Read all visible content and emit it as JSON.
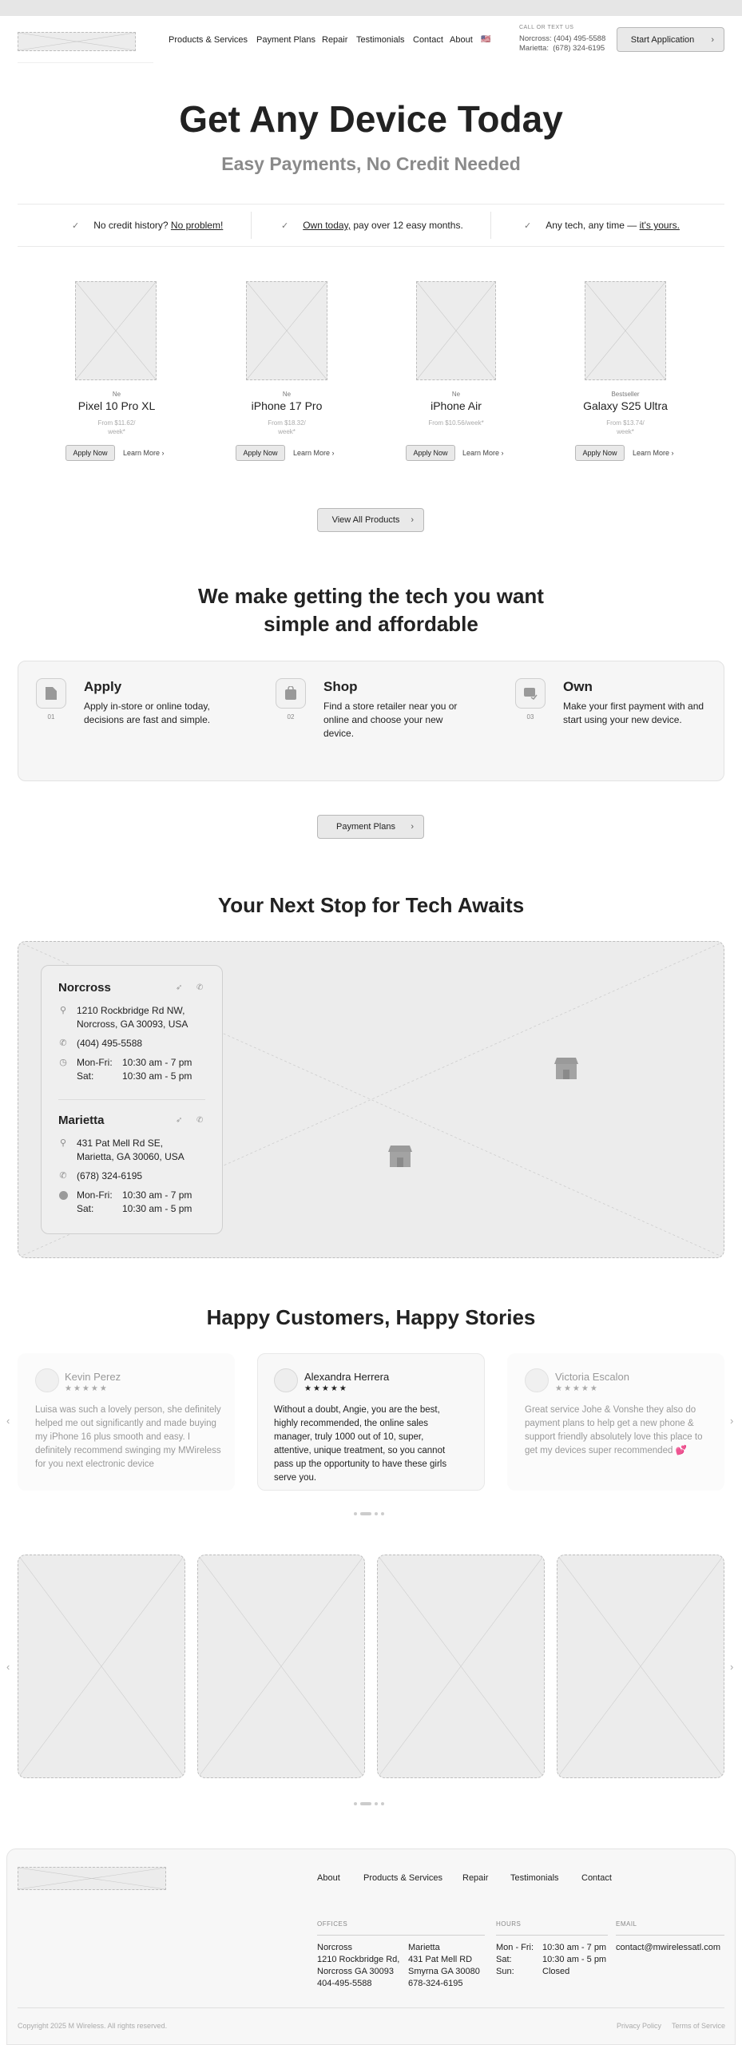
{
  "header": {
    "nav": [
      "Products & Services",
      "Payment Plans",
      "Repair",
      "Testimonials",
      "Contact",
      "About"
    ],
    "flag": "🇺🇸",
    "call_label": "CALL OR TEXT US",
    "call_lines": [
      "Norcross: (404) 495-5588",
      "Marietta:  (678) 324-6195"
    ],
    "cta": "Start Application",
    "chevron": "›"
  },
  "hero": {
    "title": "Get Any Device Today",
    "subtitle": "Easy Payments, No Credit Needed"
  },
  "features": [
    {
      "pre": "No credit history? ",
      "link": "No problem!",
      "post": ""
    },
    {
      "pre": "",
      "link": "Own today,",
      "post": " pay over 12 easy months."
    },
    {
      "pre": "Any tech, any time — ",
      "link": "it's yours.",
      "post": ""
    }
  ],
  "check_glyph": "✓",
  "products": [
    {
      "tag": "Ne",
      "title": "Pixel 10 Pro XL",
      "price1": "From $11.62/",
      "price2": "week*",
      "apply": "Apply Now",
      "learn": "Learn More ›"
    },
    {
      "tag": "Ne",
      "title": "iPhone 17 Pro",
      "price1": "From $18.32/",
      "price2": "week*",
      "apply": "Apply Now",
      "learn": "Learn More ›"
    },
    {
      "tag": "Ne",
      "title": "iPhone Air",
      "price1": "From $10.56/week*",
      "price2": "",
      "apply": "Apply Now",
      "learn": "Learn More ›"
    },
    {
      "tag": "Bestseller",
      "title": "Galaxy S25 Ultra",
      "price1": "From $13.74/",
      "price2": "week*",
      "apply": "Apply Now",
      "learn": "Learn More ›"
    }
  ],
  "view_all": "View All Products",
  "how": {
    "title": "We make getting the tech you want simple and affordable",
    "steps": [
      {
        "num": "01",
        "title": "Apply",
        "text": "Apply in-store or online today, decisions are fast and simple."
      },
      {
        "num": "02",
        "title": "Shop",
        "text": "Find a store retailer near you or online and choose your new device."
      },
      {
        "num": "03",
        "title": "Own",
        "text": "Make your first payment with and start using your new device."
      }
    ],
    "button": "Payment Plans"
  },
  "locations": {
    "title": "Your Next Stop for Tech Awaits",
    "stores": [
      {
        "name": "Norcross",
        "address": [
          "1210 Rockbridge Rd NW,",
          "Norcross, GA 30093, USA"
        ],
        "phone": "(404) 495-5588",
        "hours": [
          [
            "Mon-Fri:",
            "10:30 am - 7 pm"
          ],
          [
            "Sat:",
            "10:30 am - 5 pm"
          ]
        ]
      },
      {
        "name": "Marietta",
        "address": [
          "431 Pat Mell Rd SE,",
          "Marietta, GA 30060, USA"
        ],
        "phone": "(678) 324-6195",
        "hours": [
          [
            "Mon-Fri:",
            "10:30 am - 7 pm"
          ],
          [
            "Sat:",
            "10:30 am - 5 pm"
          ]
        ]
      }
    ]
  },
  "reviews": {
    "title": "Happy Customers, Happy Stories",
    "items": [
      {
        "name": "Kevin Perez",
        "stars": "★★★★★",
        "text": "Luisa was such a lovely person, she definitely helped me out significantly and made buying my iPhone 16 plus smooth and easy. I definitely recommend swinging my MWireless for you next electronic device"
      },
      {
        "name": "Alexandra Herrera",
        "stars": "★★★★★",
        "text": "Without a doubt, Angie, you are the best, highly recommended, the online sales manager, truly 1000 out of 10, super, attentive, unique treatment, so you cannot pass up the opportunity to have these girls serve you."
      },
      {
        "name": "Victoria Escalon",
        "stars": "★★★★★",
        "text": "Great service Johe & Vonshe they also do payment plans to help get a new phone & support friendly absolutely love this place to get my devices super recommended 💕"
      }
    ],
    "prev": "‹",
    "next": "›"
  },
  "footer": {
    "links": [
      "About",
      "Products & Services",
      "Repair",
      "Testimonials",
      "Contact"
    ],
    "offices_label": "OFFICES",
    "hours_label": "HOURS",
    "email_label": "EMAIL",
    "office1": [
      "Norcross",
      "1210 Rockbridge Rd,",
      "Norcross GA 30093",
      "404-495-5588"
    ],
    "office2": [
      "Marietta",
      "431 Pat Mell RD",
      "Smyrna GA 30080",
      "678-324-6195"
    ],
    "hours": [
      [
        "Mon - Fri:",
        "10:30 am - 7 pm"
      ],
      [
        "Sat:",
        "10:30 am - 5 pm"
      ],
      [
        "Sun:",
        "Closed"
      ]
    ],
    "email": "contact@mwirelessatl.com",
    "copyright": "Copyright 2025 M Wireless. All rights reserved.",
    "privacy": "Privacy Policy",
    "terms": "Terms of Service"
  }
}
